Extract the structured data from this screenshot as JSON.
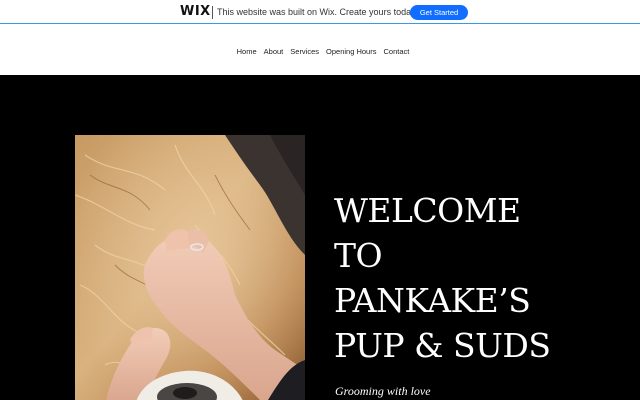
{
  "wix_banner": {
    "logo": "WIX",
    "message": "This website was built on Wix. Create yours today.",
    "cta_label": "Get Started"
  },
  "nav": {
    "items": [
      "Home",
      "About",
      "Services",
      "Opening Hours",
      "Contact"
    ]
  },
  "hero": {
    "title": "WELCOME\nTO\nPANKAKE’S\nPUP & SUDS",
    "tagline": "Grooming with love",
    "image_subject": "hands grooming a golden-haired dog"
  },
  "colors": {
    "banner_cta": "#116dff",
    "banner_border": "#3899ec",
    "hero_background": "#000000",
    "hero_text": "#ffffff"
  }
}
